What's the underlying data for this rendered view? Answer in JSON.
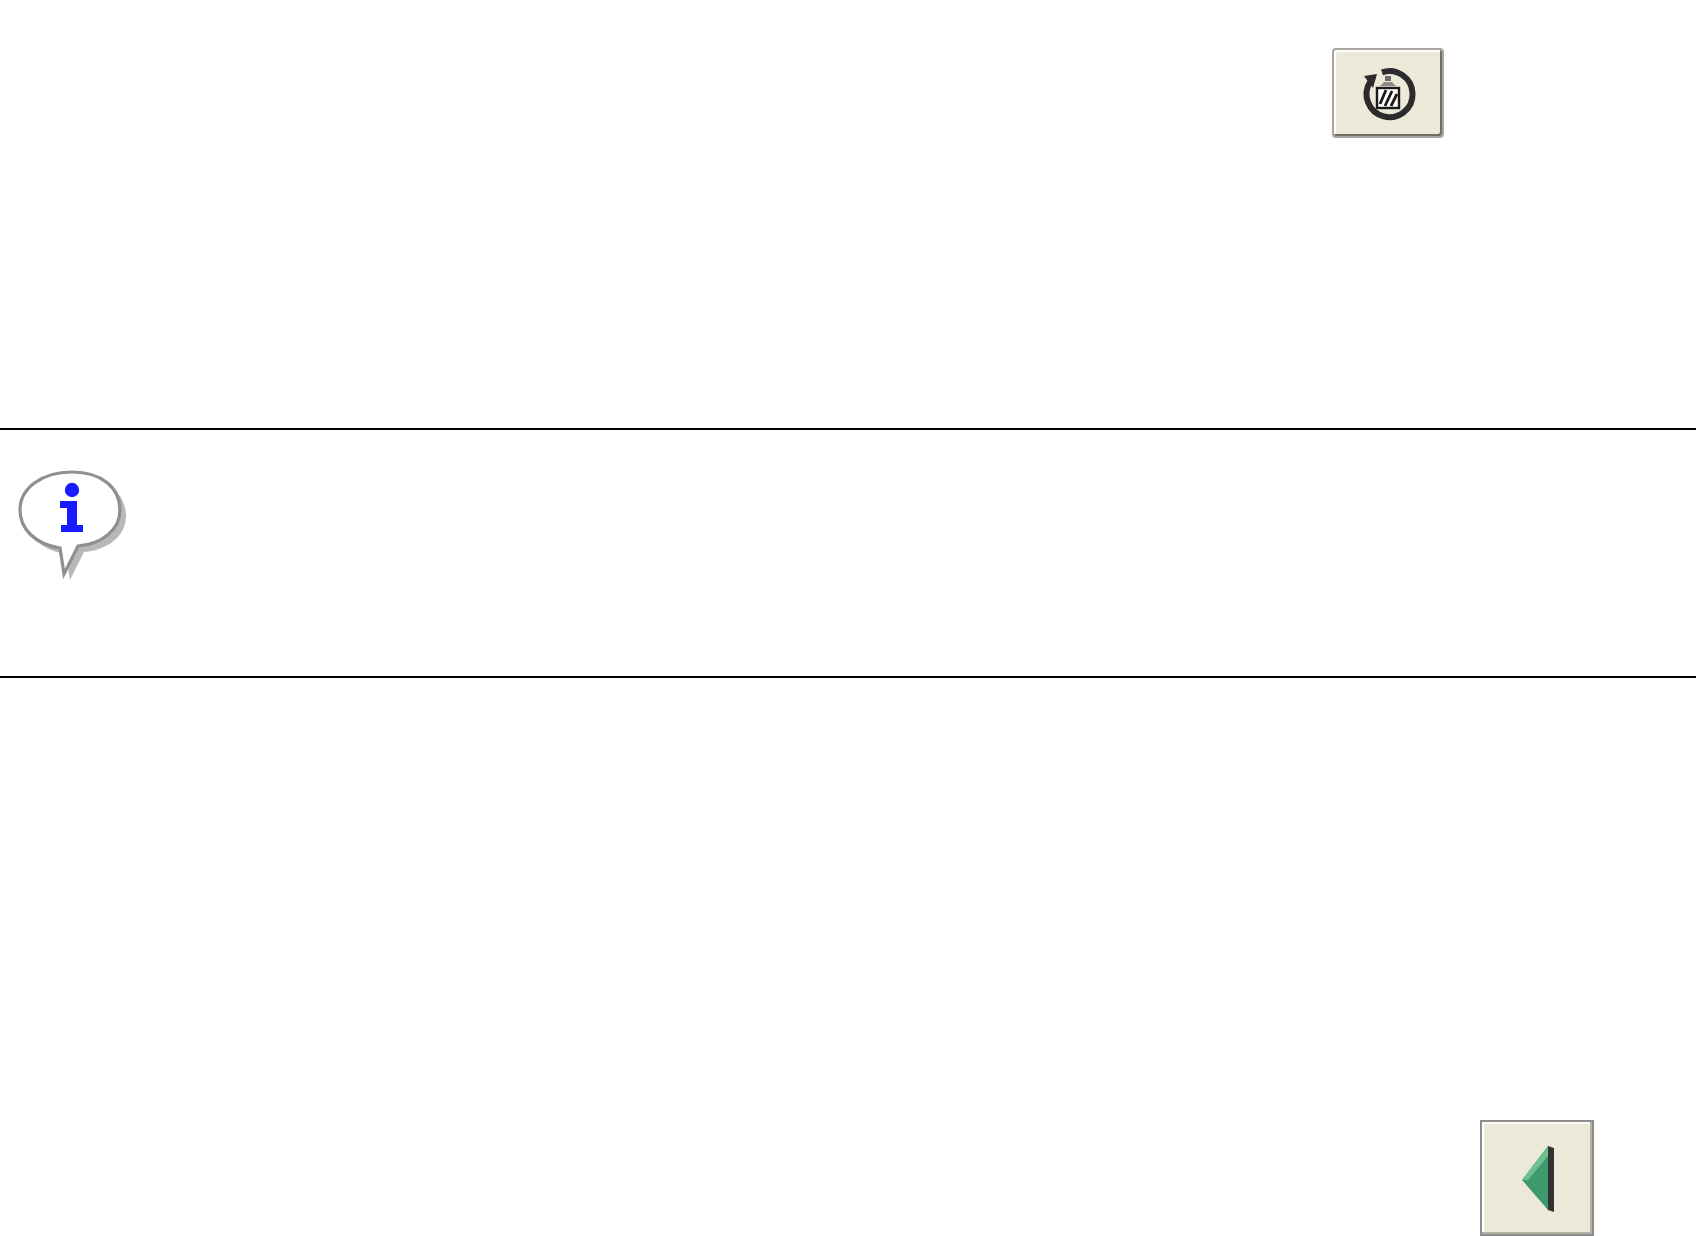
{
  "toolbar": {
    "button": {
      "kind": "reset"
    }
  },
  "note": {
    "kind": "info"
  },
  "navigation": {
    "button": {
      "kind": "back"
    }
  }
}
